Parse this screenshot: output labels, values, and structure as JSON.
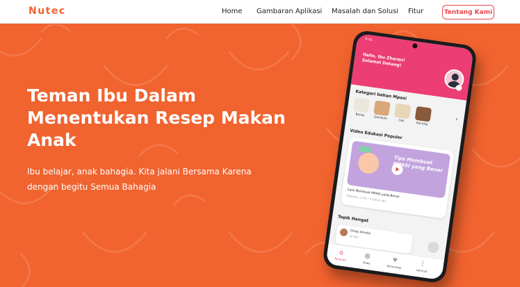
{
  "brand": {
    "name": "Nutec",
    "accent": "#F1632F",
    "button_color": "#E8454A"
  },
  "nav": {
    "links": [
      "Home",
      "Gambaran Aplikasi",
      "Masalah dan Solusi",
      "Fitur"
    ],
    "cta": "Tentang Kami"
  },
  "hero": {
    "headline": "Teman Ibu Dalam Menentukan Resep Makan Anak",
    "subtext": "Ibu belajar, anak bahagia. Kita jalani Bersama Karena dengan begitu Semua Bahagia"
  },
  "phone": {
    "status_time": "9:41",
    "greeting": "Hallo, Ibu Zharan! Selamat Datang!",
    "category_title": "Kategori bahan Mpasi",
    "categories": [
      "Beras",
      "Gandum",
      "Oat",
      "Kacang"
    ],
    "video_section_title": "Video Edukasi Populer",
    "video_overlay": "Tips Membuat MPASI yang Benar",
    "video_title": "Cara Membuat MPASI yang Benar",
    "video_meta": "Ditonton 1.2rb • 4 tahun lalu",
    "topic_section_title": "Topik Hangat",
    "topic_name": "Cindy Amelia",
    "topic_time": "20 Mei",
    "bottom_nav": [
      {
        "label": "Beranda",
        "icon": "home-icon"
      },
      {
        "label": "Video",
        "icon": "play-icon"
      },
      {
        "label": "Komunitas",
        "icon": "community-icon"
      },
      {
        "label": "Lainnya",
        "icon": "more-icon"
      }
    ]
  }
}
